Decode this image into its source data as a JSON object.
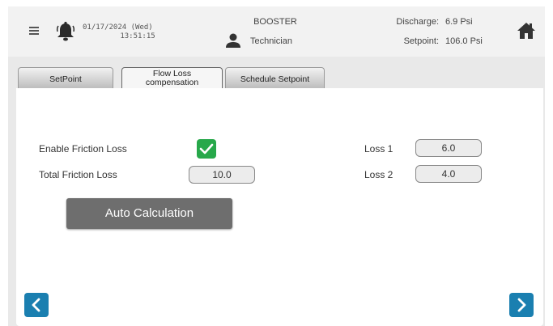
{
  "header": {
    "date": "01/17/2024 (Wed)",
    "time": "13:51:15",
    "system_name": "BOOSTER",
    "user_role": "Technician",
    "discharge_label": "Discharge:",
    "discharge_value": "6.9 Psi",
    "setpoint_label": "Setpoint:",
    "setpoint_value": "106.0 Psi",
    "icons": [
      "menu-icon",
      "bell-icon",
      "user-icon",
      "home-icon"
    ]
  },
  "tabs": [
    {
      "label": "SetPoint",
      "active": false
    },
    {
      "label_line1": "Flow Loss",
      "label_line2": "compensation",
      "active": true
    },
    {
      "label": "Schedule Setpoint",
      "active": false
    }
  ],
  "form": {
    "enable_friction_loss_label": "Enable Friction Loss",
    "enable_friction_loss_checked": true,
    "total_friction_loss_label": "Total Friction Loss",
    "total_friction_loss_value": "10.0",
    "loss1_label": "Loss 1",
    "loss1_value": "6.0",
    "loss2_label": "Loss 2",
    "loss2_value": "4.0",
    "auto_calc_label": "Auto Calculation"
  },
  "colors": {
    "accent": "#1a7fb0",
    "check": "#27a84a",
    "button": "#6e6e6e"
  }
}
